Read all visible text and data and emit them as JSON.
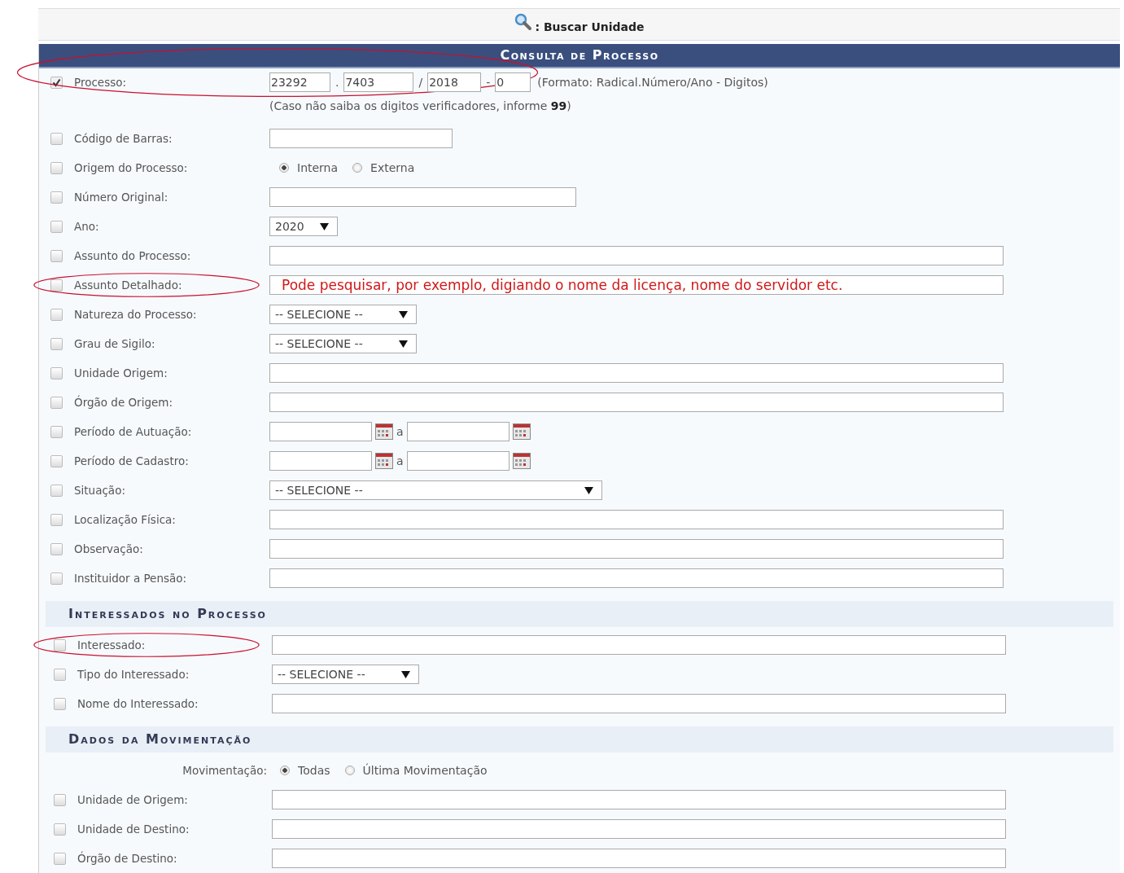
{
  "search_bar": {
    "text": ": Buscar Unidade"
  },
  "form": {
    "title": "Consulta de Processo",
    "sections": [
      {
        "rows": [
          {
            "kind": "process",
            "label": "Processo:",
            "checked": true,
            "circled": true,
            "parts": [
              {
                "value": "23292"
              },
              {
                "sep": ".",
                "value": "7403"
              },
              {
                "sep": "/",
                "value": "2018"
              },
              {
                "sep": "-",
                "value": "0"
              }
            ],
            "format": "(Formato: Radical.Número/Ano - Digitos)",
            "hint": "(Caso não saiba os digitos verificadores, informe **99**)"
          },
          {
            "kind": "shorttext",
            "label": "Código de Barras:",
            "checked": false
          },
          {
            "kind": "radio",
            "label": "Origem do Processo:",
            "checked": false,
            "options": [
              {
                "label": "Interna",
                "selected": true
              },
              {
                "label": "Externa",
                "selected": false
              }
            ]
          },
          {
            "kind": "mediumtext",
            "label": "Número Original:",
            "checked": false
          },
          {
            "kind": "narrowselect",
            "label": "Ano:",
            "checked": false,
            "value": "2020"
          },
          {
            "kind": "text",
            "label": "Assunto do Processo:",
            "checked": false
          },
          {
            "kind": "text",
            "label": "Assunto Detalhado:",
            "checked": false,
            "circled": true,
            "note": "Pode pesquisar, por exemplo, digiando o nome da licença, nome do servidor etc."
          },
          {
            "kind": "select",
            "label": "Natureza do Processo:",
            "checked": false,
            "value": "-- SELECIONE --"
          },
          {
            "kind": "select",
            "label": "Grau de Sigilo:",
            "checked": false,
            "value": "-- SELECIONE --"
          },
          {
            "kind": "text",
            "label": "Unidade Origem:",
            "checked": false
          },
          {
            "kind": "text",
            "label": "Órgão de Origem:",
            "checked": false
          },
          {
            "kind": "daterange",
            "label": "Período de Autuação:",
            "checked": false,
            "separator": "a"
          },
          {
            "kind": "daterange",
            "label": "Período de Cadastro:",
            "checked": false,
            "separator": "a"
          },
          {
            "kind": "wideselect",
            "label": "Situação:",
            "checked": false,
            "value": "-- SELECIONE --"
          },
          {
            "kind": "text",
            "label": "Localização Física:",
            "checked": false
          },
          {
            "kind": "text",
            "label": "Observação:",
            "checked": false
          },
          {
            "kind": "text",
            "label": "Instituidor a Pensão:",
            "checked": false
          }
        ]
      },
      {
        "title": "Interessados no Processo",
        "rows": [
          {
            "kind": "text",
            "label": "Interessado:",
            "checked": false,
            "circled": true
          },
          {
            "kind": "select",
            "label": "Tipo do Interessado:",
            "checked": false,
            "value": "-- SELECIONE --"
          },
          {
            "kind": "text",
            "label": "Nome do Interessado:",
            "checked": false
          }
        ]
      },
      {
        "title": "Dados da Movimentação",
        "rows": [
          {
            "kind": "radio",
            "label": "Movimentação:",
            "options": [
              {
                "label": "Todas",
                "selected": true
              },
              {
                "label": "Última Movimentação",
                "selected": false
              }
            ]
          },
          {
            "kind": "text",
            "label": "Unidade de Origem:",
            "checked": false
          },
          {
            "kind": "text",
            "label": "Unidade de Destino:",
            "checked": false
          },
          {
            "kind": "text",
            "label": "Órgão de Destino:",
            "checked": false
          }
        ]
      }
    ]
  }
}
